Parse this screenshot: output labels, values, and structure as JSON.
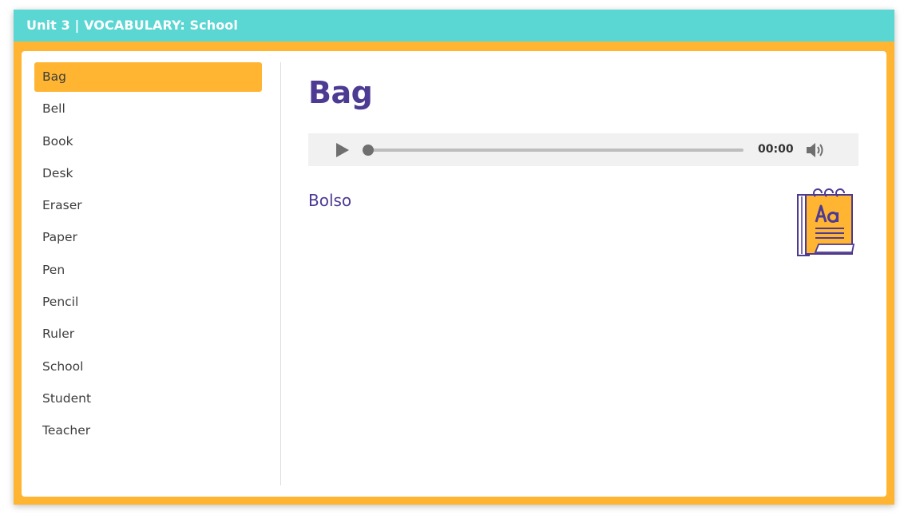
{
  "window": {
    "title": "Unit 3 | VOCABULARY: School"
  },
  "sidebar": {
    "items": [
      {
        "label": "Bag",
        "active": true
      },
      {
        "label": "Bell",
        "active": false
      },
      {
        "label": "Book",
        "active": false
      },
      {
        "label": "Desk",
        "active": false
      },
      {
        "label": "Eraser",
        "active": false
      },
      {
        "label": "Paper",
        "active": false
      },
      {
        "label": "Pen",
        "active": false
      },
      {
        "label": "Pencil",
        "active": false
      },
      {
        "label": "Ruler",
        "active": false
      },
      {
        "label": "School",
        "active": false
      },
      {
        "label": "Student",
        "active": false
      },
      {
        "label": "Teacher",
        "active": false
      }
    ]
  },
  "main": {
    "word": "Bag",
    "translation": "Bolso",
    "audio": {
      "time": "00:00",
      "progress": 0,
      "play_icon": "play-icon",
      "volume_icon": "volume-icon"
    },
    "illustration_icon": "dictionary-book-icon"
  },
  "colors": {
    "titlebar": "#5ad6d3",
    "frame": "#ffb531",
    "accent_text": "#4d3a93",
    "active_item": "#ffb531"
  }
}
